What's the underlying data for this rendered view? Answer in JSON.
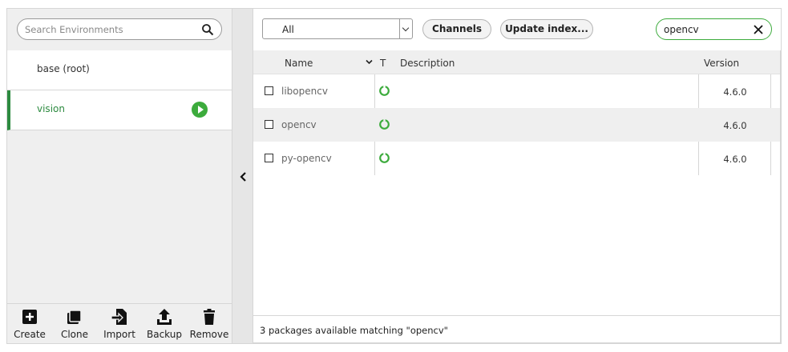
{
  "environments": {
    "search_placeholder": "Search Environments",
    "items": [
      {
        "name": "base (root)",
        "active": false
      },
      {
        "name": "vision",
        "active": true
      }
    ],
    "actions": [
      {
        "label": "Create",
        "icon": "plus-square-icon"
      },
      {
        "label": "Clone",
        "icon": "copy-icon"
      },
      {
        "label": "Import",
        "icon": "import-icon"
      },
      {
        "label": "Backup",
        "icon": "upload-icon"
      },
      {
        "label": "Remove",
        "icon": "trash-icon"
      }
    ]
  },
  "toolbar": {
    "filter_value": "All",
    "channels_label": "Channels",
    "update_index_label": "Update index...",
    "search_value": "opencv"
  },
  "table": {
    "columns": {
      "name": "Name",
      "type": "T",
      "description": "Description",
      "version": "Version"
    },
    "rows": [
      {
        "name": "libopencv",
        "description": "",
        "version": "4.6.0"
      },
      {
        "name": "opencv",
        "description": "",
        "version": "4.6.0"
      },
      {
        "name": "py-opencv",
        "description": "",
        "version": "4.6.0"
      }
    ]
  },
  "status_text": "3 packages available matching \"opencv\"",
  "colors": {
    "accent_green": "#3cab3c",
    "active_env_text": "#2c8a3f",
    "panel_bg": "#efefef"
  }
}
